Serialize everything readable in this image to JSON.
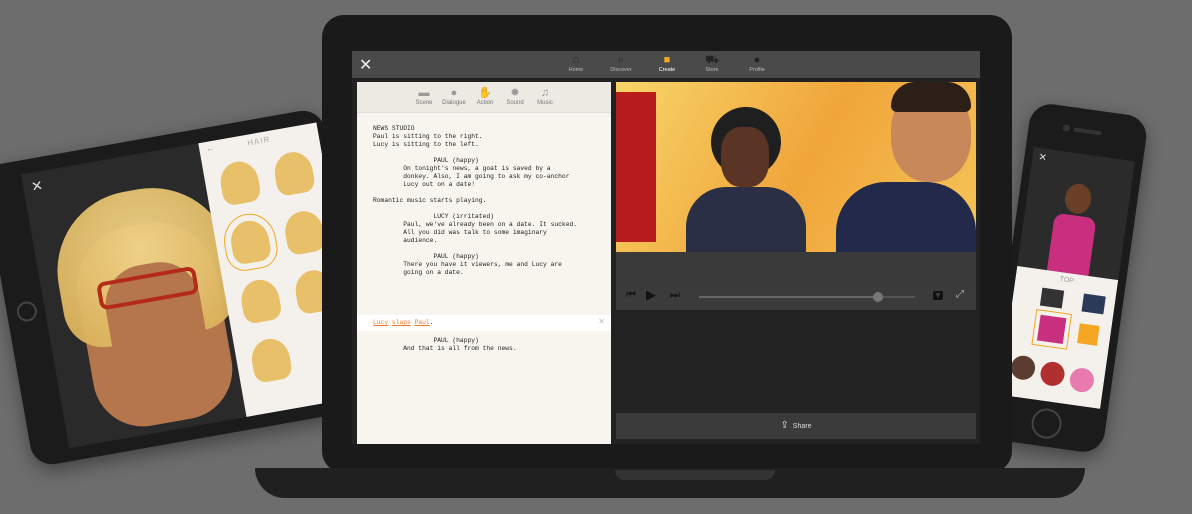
{
  "tablet": {
    "close_icon": "close-icon",
    "panel_title": "HAIR",
    "back_icon": "arrow-left-icon"
  },
  "laptop": {
    "nav": {
      "close_icon": "close-icon",
      "items": [
        {
          "label": "Home",
          "icon": "⌂"
        },
        {
          "label": "Discover",
          "icon": "⌕"
        },
        {
          "label": "Create",
          "icon": "■"
        },
        {
          "label": "Store",
          "icon": "⛟"
        },
        {
          "label": "Profile",
          "icon": "●"
        }
      ],
      "active": "Create",
      "accent": "#f2a623"
    },
    "toolbar": [
      {
        "label": "Scene",
        "icon": "▬"
      },
      {
        "label": "Dialogue",
        "icon": "●"
      },
      {
        "label": "Action",
        "icon": "✋"
      },
      {
        "label": "Sound",
        "icon": "✹"
      },
      {
        "label": "Music",
        "icon": "♫"
      }
    ],
    "script_top": "NEWS STUDIO\nPaul is sitting to the right.\nLucy is sitting to the left.\n\n                PAUL (happy)\n        On tonight's news, a goat is saved by a\n        donkey. Also, I am going to ask my co-anchor\n        Lucy out on a date!\n\nRomantic music starts playing.\n\n                LUCY (irritated)\n        Paul, we've already been on a date. It sucked.\n        All you did was talk to some imaginary\n        audience.\n\n                PAUL (happy)\n        There you have it viewers, me and Lucy are\n        going on a date.",
    "highlight": {
      "actor1": "Lucy",
      "verb": "slaps",
      "actor2": "Paul",
      "end": "."
    },
    "script_bottom": "                PAUL (happy)\n        And that is all from the news.",
    "player": {
      "progress": 0.83
    },
    "share_label": "Share"
  },
  "phone": {
    "panel_title": "TOP",
    "close_icon": "close-icon"
  }
}
